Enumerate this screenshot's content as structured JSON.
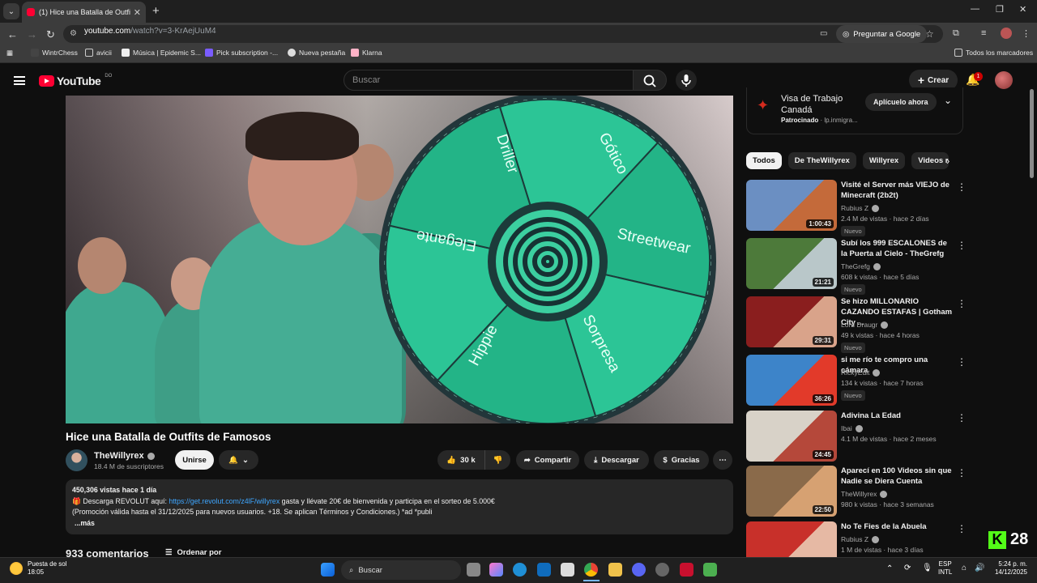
{
  "browser": {
    "tab_title": "(1) Hice una Batalla de Outfits d",
    "url_host": "youtube.com",
    "url_path": "/watch?v=3-KrAejUuM4",
    "ask_google": "Preguntar a Google",
    "bookmarks": [
      "WintrChess",
      "avicii",
      "Música | Epidemic S...",
      "Pick subscription -...",
      "Nueva pestaña",
      "Klarna"
    ],
    "all_bookmarks": "Todos los marcadores"
  },
  "youtube": {
    "logo": "YouTube",
    "region": "DO",
    "search_placeholder": "Buscar",
    "create": "Crear",
    "notifications": "1"
  },
  "video": {
    "wheel_labels": [
      "Driller",
      "Gótico",
      "Streetwear",
      "Sorpresa",
      "Hippie",
      "Elegante"
    ],
    "title": "Hice una Batalla de Outfits de Famosos",
    "channel": "TheWillyrex",
    "subscribers": "18.4 M de suscriptores",
    "join": "Unirse",
    "likes": "30 k",
    "share": "Compartir",
    "download": "Descargar",
    "thanks": "Gracias"
  },
  "description": {
    "stats": "450,306 vistas  hace 1 día",
    "line1_pre": "🎁 Descarga REVOLUT aquí: ",
    "line1_link": "https://get.revolut.com/z4lF/willyrex",
    "line1_post": " gasta y llévate 20€ de bienvenida y participa en el sorteo de 5.000€",
    "line2": "(Promoción válida hasta el 31/12/2025 para nuevos usuarios. +18. Se aplican Términos y Condiciones.) *ad  *publi",
    "more": "...más"
  },
  "comments": {
    "count": "933 comentarios",
    "sort": "Ordenar por"
  },
  "ad": {
    "title_line1": "Visa de Trabajo",
    "title_line2": "Canadá",
    "sponsored": "Patrocinado",
    "domain": "· lp.inmigra...",
    "cta": "Aplícuelo ahora"
  },
  "chips": [
    "Todos",
    "De TheWillyrex",
    "Willyrex",
    "Videos re"
  ],
  "recommendations": [
    {
      "title": "Visité el Server más VIEJO de Minecraft (2b2t)",
      "channel": "Rubius Z",
      "meta": "2.4 M de vistas · hace 2 días",
      "duration": "1:00:43",
      "new": "Nuevo",
      "colors": [
        "#6b8fc2",
        "#c46a3a"
      ]
    },
    {
      "title": "Subí los 999 ESCALONES de la Puerta al Cielo - TheGrefg",
      "channel": "TheGrefg",
      "meta": "608 k vistas · hace 5 días",
      "duration": "21:21",
      "new": "Nuevo",
      "colors": [
        "#4d7a3a",
        "#b9c7c9"
      ]
    },
    {
      "title": "Se hizo MILLONARIO CAZANDO ESTAFAS | Gotham City ...",
      "channel": "Lord Draugr",
      "meta": "49 k vistas · hace 4 horas",
      "duration": "29:31",
      "new": "Nuevo",
      "colors": [
        "#8a1e1e",
        "#d9a38a"
      ]
    },
    {
      "title": "si me río te compro una cámara",
      "channel": "RickyEdit",
      "meta": "134 k vistas · hace 7 horas",
      "duration": "36:26",
      "new": "Nuevo",
      "colors": [
        "#3d84c9",
        "#e23a2a"
      ]
    },
    {
      "title": "Adivina La Edad",
      "channel": "Ibai",
      "meta": "4.1 M de vistas · hace 2 meses",
      "duration": "24:45",
      "new": "",
      "colors": [
        "#d8d2c8",
        "#b5483a"
      ]
    },
    {
      "title": "Aparecí en 100 Videos sin que Nadie se Diera Cuenta",
      "channel": "TheWillyrex",
      "meta": "980 k vistas · hace 3 semanas",
      "duration": "22:50",
      "new": "",
      "colors": [
        "#8a6a4a",
        "#d6a172"
      ]
    },
    {
      "title": "No Te Fies de la Abuela",
      "channel": "Rubius Z",
      "meta": "1 M de vistas · hace 3 días",
      "duration": "",
      "new": "",
      "colors": [
        "#c8302a",
        "#e6b9a4"
      ]
    }
  ],
  "overlay": {
    "kick_count": "28"
  },
  "taskbar": {
    "weather_title": "Puesta de sol",
    "weather_time": "18:05",
    "search": "Buscar",
    "lang1": "ESP",
    "lang2": "INTL",
    "time": "5:24 p. m.",
    "date": "14/12/2025"
  }
}
